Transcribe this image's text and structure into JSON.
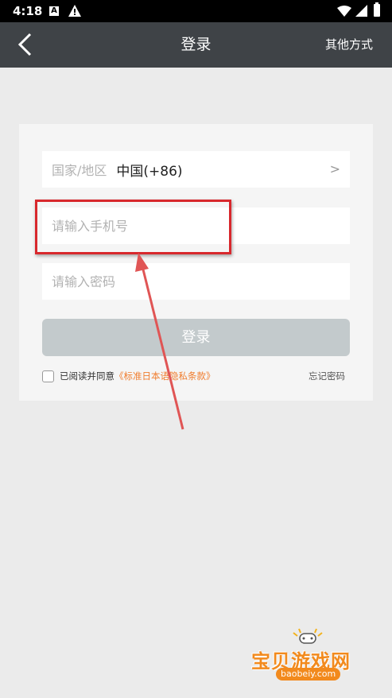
{
  "status": {
    "time": "4:18",
    "a_icon_letter": "A"
  },
  "nav": {
    "title": "登录",
    "right_action": "其他方式"
  },
  "form": {
    "country_label": "国家/地区",
    "country_value": "中国(+86)",
    "country_arrow": ">",
    "phone_placeholder": "请输入手机号",
    "password_placeholder": "请输入密码",
    "login_label": "登录",
    "agree_text": "已阅读并同意",
    "privacy_link": "《标准日本语隐私条款》",
    "forgot_password": "忘记密码"
  },
  "watermark": {
    "text": "宝贝游戏网",
    "url": "baobeiy.com"
  },
  "colors": {
    "nav_bg": "#3f4347",
    "button_disabled": "#c3cacc",
    "link": "#f07d2e",
    "annotation": "#d8282d"
  },
  "icons": [
    "back-chevron-icon",
    "warning-icon",
    "wifi-icon",
    "signal-icon",
    "battery-icon",
    "gamepad-icon"
  ]
}
